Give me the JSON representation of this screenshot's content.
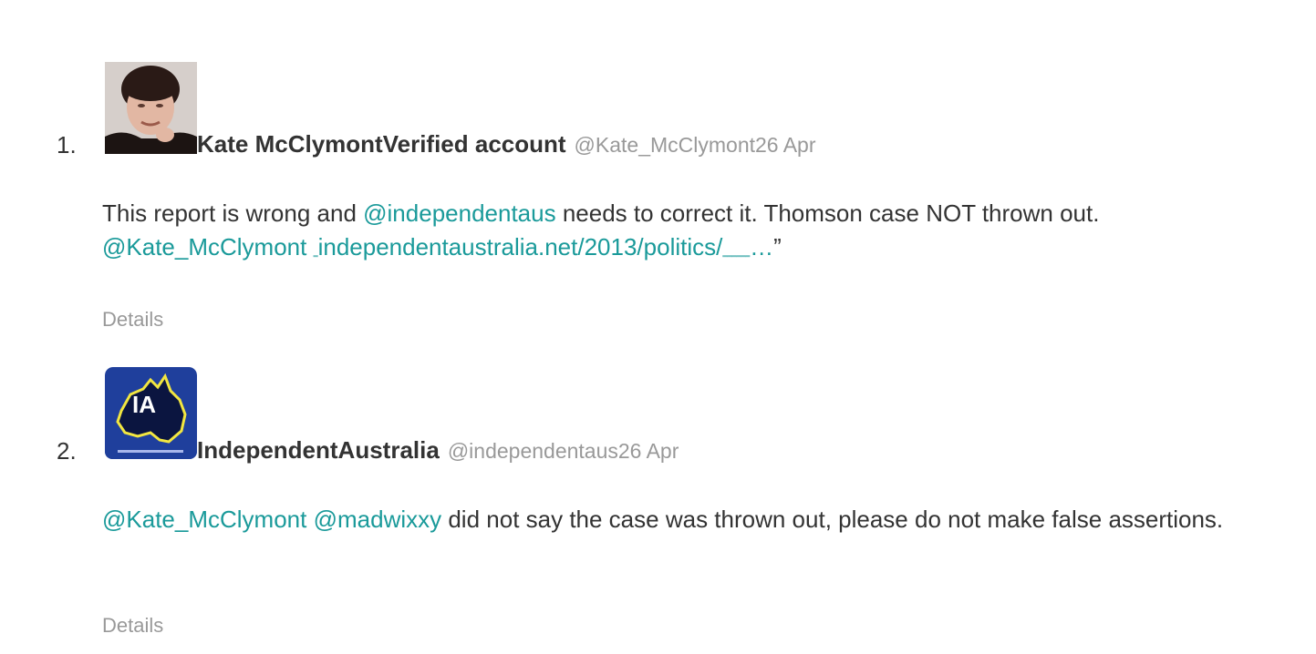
{
  "tweets": [
    {
      "number": "1.",
      "name": "Kate McClymont",
      "verified": "Verified account",
      "handle": "@Kate_McClymont",
      "date": "26 Apr",
      "text_part1": "This report is wrong and ",
      "mention1": "@independentaus",
      "text_part2": " needs to correct it. Thomson case NOT thrown out.",
      "mention2": "@Kate_McClymont",
      "link": "independentaustralia.net/2013/politics/",
      "link_tail": "…",
      "close_quote": "”",
      "details": "Details"
    },
    {
      "number": "2.",
      "name": "IndependentAustralia",
      "handle": "@independentaus",
      "date": "26 Apr",
      "mention1": "@Kate_McClymont",
      "mention2": "@madwixxy",
      "text_part1": " did not say the case was thrown out, please do not make false assertions.",
      "details": "Details",
      "avatar_text": "IA"
    }
  ],
  "colors": {
    "mention": "#1a9a9a",
    "muted": "#999999",
    "text": "#333333"
  }
}
